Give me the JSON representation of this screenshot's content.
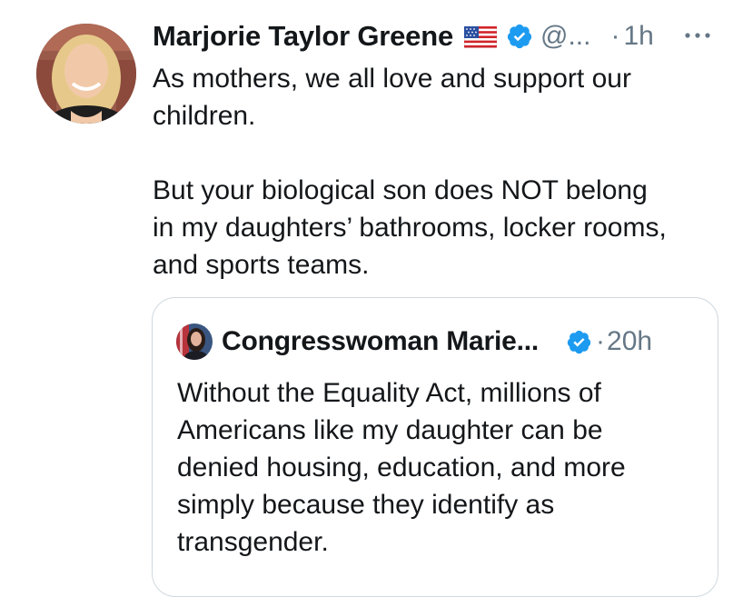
{
  "tweet": {
    "author_name": "Marjorie Taylor Greene",
    "flag_icon": "us-flag-icon",
    "verified_icon": "verified-badge-icon",
    "handle": "@...",
    "separator": "·",
    "time": "1h",
    "more_icon": "more-options-icon",
    "text": "As mothers, we all love and support our\nchildren.\n\nBut your biological son does NOT belong\nin my daughters’ bathrooms, locker rooms,\nand sports teams."
  },
  "quote": {
    "author_name": "Congresswoman Marie...",
    "verified_icon": "verified-badge-icon",
    "separator": "·",
    "time": "20h",
    "text": "Without the Equality Act, millions of\nAmericans like my daughter can be\ndenied housing, education, and more\nsimply because they identify as\ntransgender."
  },
  "colors": {
    "text": "#14171a",
    "secondary": "#657786",
    "verified": "#1d9bf0",
    "border": "#cfd9de"
  }
}
